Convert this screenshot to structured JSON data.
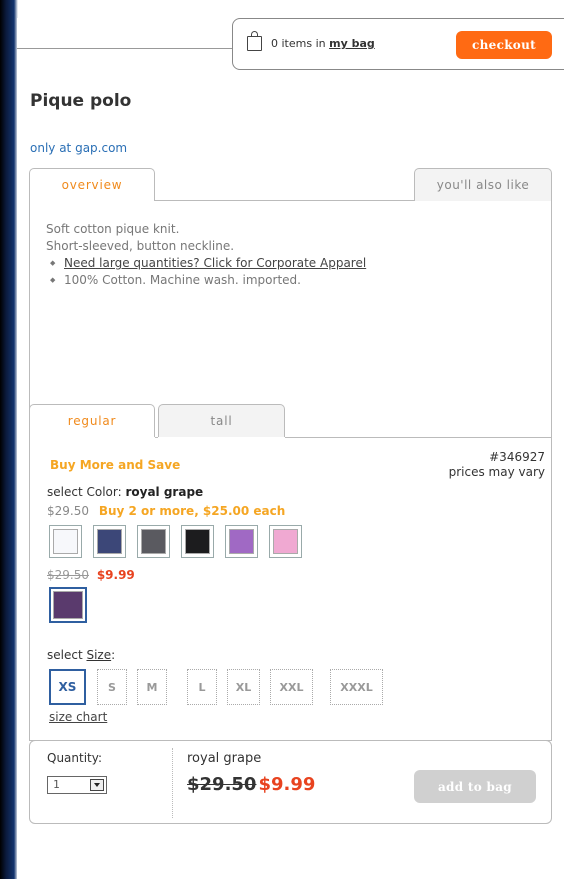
{
  "bag": {
    "summary": "0 items in",
    "link": "my bag",
    "checkout_label": "checkout"
  },
  "product": {
    "title": "Pique polo",
    "exclusive": "only at gap.com",
    "style_number": "#346927",
    "prices_note": "prices may vary"
  },
  "tabs": {
    "overview": "overview",
    "also_like": "you'll also like",
    "regular": "regular",
    "tall": "tall"
  },
  "description": {
    "line1": "Soft cotton pique knit.",
    "line2": "Short-sleeved, button neckline.",
    "bullets": [
      "Need large quantities? Click for Corporate Apparel",
      "100% Cotton. Machine wash. imported."
    ]
  },
  "promo": {
    "headline": "Buy More and Save",
    "color_prefix": "select Color:",
    "color_name": "royal grape",
    "regular_price": "$29.50",
    "multi_buy": "Buy 2 or more, $25.00 each",
    "sale_old": "$29.50",
    "sale_new": "$9.99"
  },
  "swatches": {
    "row1": [
      "#f7f8fb",
      "#3c4778",
      "#5a5a60",
      "#1c1c1e",
      "#a069c4",
      "#f0a9d2"
    ],
    "sale": [
      "#5a3a6d"
    ]
  },
  "sizes": {
    "label_prefix": "select",
    "label_link": "Size",
    "label_suffix": ":",
    "options": [
      "XS",
      "S",
      "M",
      "L",
      "XL",
      "XXL",
      "XXXL"
    ],
    "selected": "XS",
    "chart_link": "size chart"
  },
  "add": {
    "qty_label": "Quantity:",
    "qty_value": "1",
    "color": "royal grape",
    "old_price": "$29.50",
    "new_price": "$9.99",
    "button": "add to bag"
  }
}
